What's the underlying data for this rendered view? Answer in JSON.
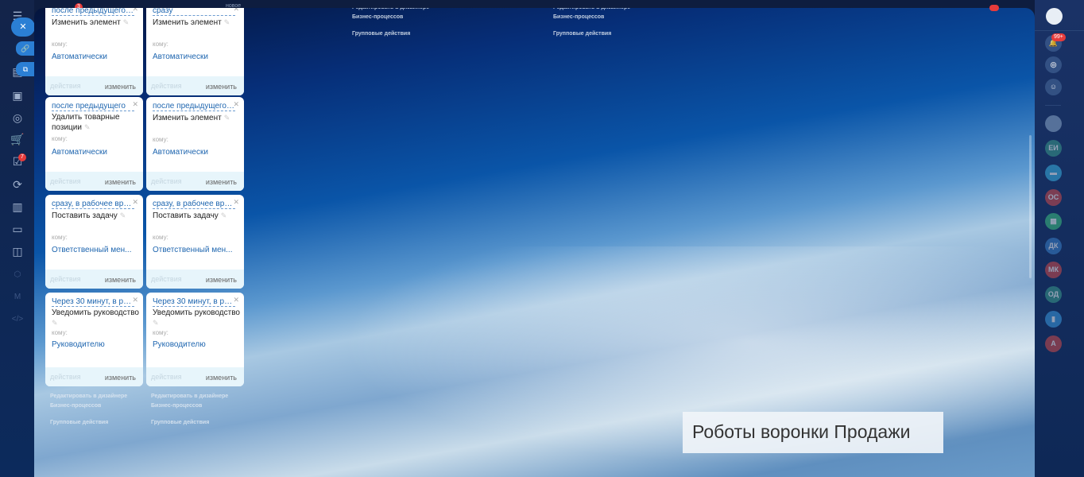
{
  "top": {
    "new_label": "новое",
    "tasks_badge": "3",
    "notifications_badge": "99+",
    "tasks_count": "7"
  },
  "cards": [
    {
      "when": "после предыдущего, п...",
      "action": "Изменить элемент",
      "to": "кому:",
      "who": "Автоматически"
    },
    {
      "when": "сразу",
      "action": "Изменить элемент",
      "to": "кому:",
      "who": "Автоматически"
    },
    {
      "when": "после предыдущего",
      "action": "Удалить товарные позиции",
      "to": "кому:",
      "who": "Автоматически"
    },
    {
      "when": "после предыдущего, п...",
      "action": "Изменить элемент",
      "to": "кому:",
      "who": "Автоматически"
    },
    {
      "when": "сразу, в рабочее врем...",
      "action": "Поставить задачу",
      "to": "кому:",
      "who": "Ответственный мен..."
    },
    {
      "when": "сразу, в рабочее врем...",
      "action": "Поставить задачу",
      "to": "кому:",
      "who": "Ответственный мен..."
    },
    {
      "when": "Через 30 минут, в раб...",
      "action": "Уведомить руководство",
      "to": "кому:",
      "who": "Руководителю"
    },
    {
      "when": "Через 30 минут, в раб...",
      "action": "Уведомить руководство",
      "to": "кому:",
      "who": "Руководителю"
    }
  ],
  "card_footer": {
    "actions": "действия",
    "edit": "изменить"
  },
  "column_footer": {
    "designer": "Редактировать в дизайнере",
    "bp": "Бизнес-процессов",
    "group": "Групповые действия"
  },
  "avatars": [
    "ЕИ",
    "ОС",
    "ДК",
    "МК",
    "ОД",
    "А"
  ],
  "caption": "Роботы воронки Продажи"
}
